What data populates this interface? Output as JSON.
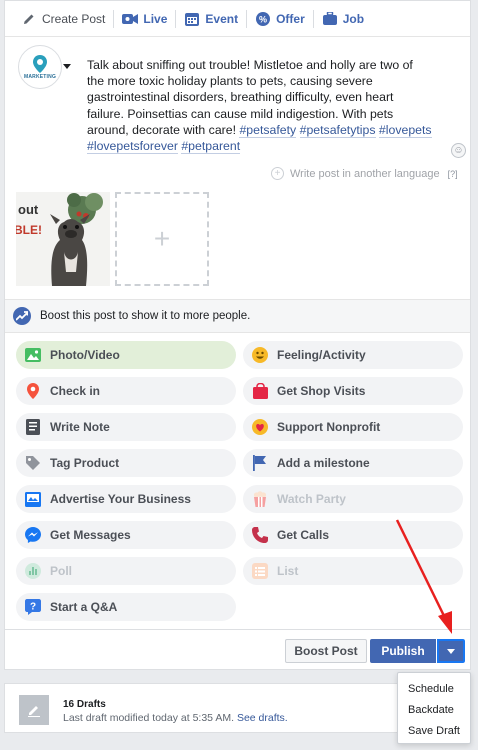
{
  "tabs": [
    {
      "label": "Create Post",
      "icon": "pencil-icon"
    },
    {
      "label": "Live",
      "icon": "video-camera-icon"
    },
    {
      "label": "Event",
      "icon": "calendar-icon"
    },
    {
      "label": "Offer",
      "icon": "percent-tag-icon"
    },
    {
      "label": "Job",
      "icon": "briefcase-icon"
    }
  ],
  "composer": {
    "avatar_brand": "MARKETING",
    "text_plain": "Talk about sniffing out trouble! Mistletoe and holly are two of the more toxic holiday plants to pets, causing severe gastrointestinal disorders, breathing difficulty, even heart failure. Poinsettias can cause mild indigestion.  With pets around, decorate with care! ",
    "hashtags": [
      "#petsafety",
      "#petsafetytips",
      "#lovepets",
      "#lovepetsforever",
      "#petparent"
    ],
    "write_another_language": "Write post in another language",
    "help_mark": "[?]",
    "add_photo_symbol": "+",
    "thumbnail_caption_fragment": "out",
    "thumbnail_caption_fragment2": "BLE!"
  },
  "boost_prompt": "Boost this post to show it to more people.",
  "options": [
    {
      "label": "Photo/Video",
      "icon": "photo-icon",
      "color": "#45bd62"
    },
    {
      "label": "Feeling/Activity",
      "icon": "smiley-icon",
      "color": "#f7b928"
    },
    {
      "label": "Check in",
      "icon": "location-pin-icon",
      "color": "#f5533d"
    },
    {
      "label": "Get Shop Visits",
      "icon": "shopping-bag-icon",
      "color": "#e42645"
    },
    {
      "label": "Write Note",
      "icon": "note-icon",
      "color": "#4b4f56"
    },
    {
      "label": "Support Nonprofit",
      "icon": "heart-coin-icon",
      "color": "#e42645"
    },
    {
      "label": "Tag Product",
      "icon": "price-tag-icon",
      "color": "#90949c"
    },
    {
      "label": "Add a milestone",
      "icon": "flag-icon",
      "color": "#4267b2"
    },
    {
      "label": "Advertise Your Business",
      "icon": "advertise-icon",
      "color": "#1877f2"
    },
    {
      "label": "Watch Party",
      "icon": "popcorn-icon",
      "color": "#f5a0a0"
    },
    {
      "label": "Get Messages",
      "icon": "messenger-icon",
      "color": "#1877f2"
    },
    {
      "label": "Get Calls",
      "icon": "phone-icon",
      "color": "#c4314b"
    },
    {
      "label": "Poll",
      "icon": "poll-icon",
      "color": "#a8d8c0"
    },
    {
      "label": "List",
      "icon": "list-icon",
      "color": "#f7c2a0"
    },
    {
      "label": "Start a Q&A",
      "icon": "question-icon",
      "color": "#3578e5"
    }
  ],
  "actions": {
    "boost_post": "Boost Post",
    "publish": "Publish"
  },
  "publish_menu": [
    "Schedule",
    "Backdate",
    "Save Draft"
  ],
  "drafts": {
    "title": "16 Drafts",
    "subtitle": "Last draft modified today at 5:35 AM.",
    "link": "See drafts."
  },
  "colors": {
    "accent": "#4267b2",
    "annotation_arrow": "#e8201f"
  }
}
